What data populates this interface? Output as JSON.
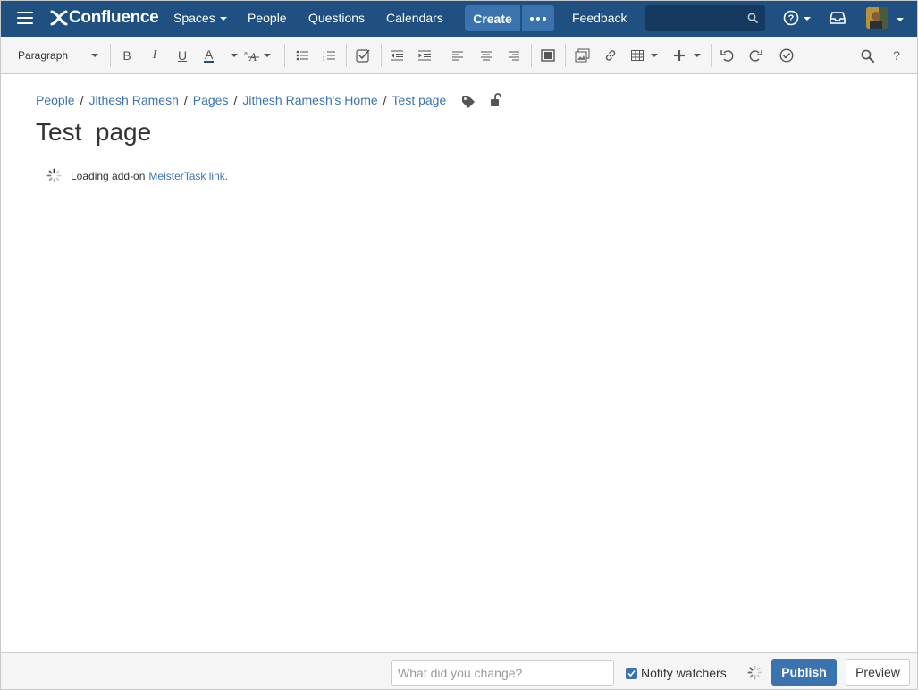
{
  "header": {
    "logo_text": "Confluence",
    "nav": [
      {
        "label": "Spaces",
        "has_dropdown": true
      },
      {
        "label": "People"
      },
      {
        "label": "Questions"
      },
      {
        "label": "Calendars"
      }
    ],
    "create_label": "Create",
    "feedback_label": "Feedback",
    "search_placeholder": "",
    "colors": {
      "nav_bg": "#205081",
      "button_bg": "#3b73af",
      "search_bg": "#163a5f"
    },
    "icons": [
      "menu-icon",
      "more-icon",
      "search-icon",
      "help-icon",
      "inbox-icon",
      "user-avatar"
    ]
  },
  "toolbar": {
    "paragraph_label": "Paragraph",
    "icons": [
      "bold-icon",
      "italic-icon",
      "underline-icon",
      "text-color-icon",
      "text-format-icon",
      "bullet-list-icon",
      "numbered-list-icon",
      "task-list-icon",
      "outdent-icon",
      "indent-icon",
      "align-left-icon",
      "align-center-icon",
      "align-right-icon",
      "page-layout-icon",
      "insert-image-icon",
      "link-icon",
      "table-icon",
      "insert-more-icon",
      "undo-icon",
      "redo-icon",
      "check-icon",
      "find-icon",
      "help-icon"
    ],
    "bold_glyph": "B",
    "italic_glyph": "I",
    "underline_glyph": "U",
    "color_glyph": "A",
    "help_glyph": "?"
  },
  "breadcrumb": [
    {
      "label": "People"
    },
    {
      "label": "Jithesh Ramesh"
    },
    {
      "label": "Pages"
    },
    {
      "label": "Jithesh Ramesh's Home"
    },
    {
      "label": "Test page"
    }
  ],
  "page": {
    "title": "Test  page",
    "loading_text": "Loading add-on",
    "loading_link": "MeisterTask link."
  },
  "footer": {
    "change_placeholder": "What did you change?",
    "notify_label": "Notify watchers",
    "notify_checked": true,
    "publish_label": "Publish",
    "preview_label": "Preview"
  }
}
